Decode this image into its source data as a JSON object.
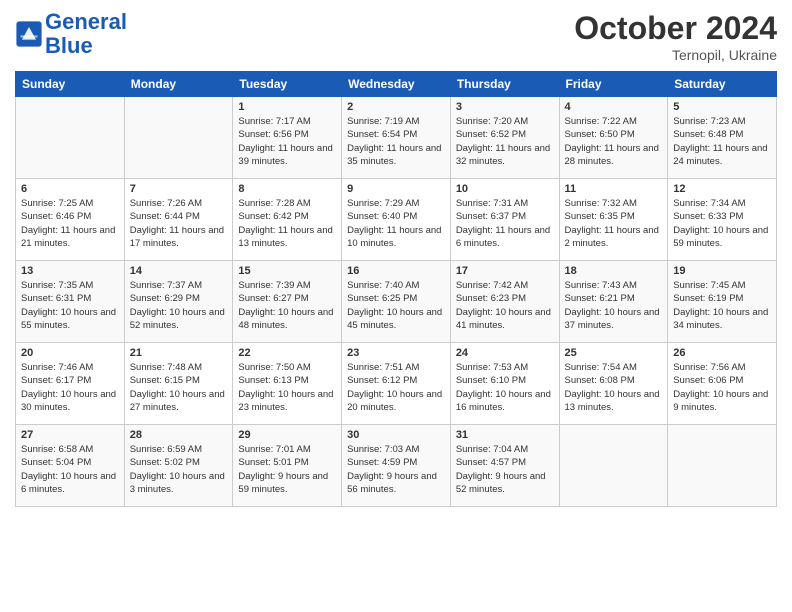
{
  "header": {
    "logo_line1": "General",
    "logo_line2": "Blue",
    "month": "October 2024",
    "location": "Ternopil, Ukraine"
  },
  "weekdays": [
    "Sunday",
    "Monday",
    "Tuesday",
    "Wednesday",
    "Thursday",
    "Friday",
    "Saturday"
  ],
  "weeks": [
    [
      {
        "day": "",
        "info": ""
      },
      {
        "day": "",
        "info": ""
      },
      {
        "day": "1",
        "info": "Sunrise: 7:17 AM\nSunset: 6:56 PM\nDaylight: 11 hours and 39 minutes."
      },
      {
        "day": "2",
        "info": "Sunrise: 7:19 AM\nSunset: 6:54 PM\nDaylight: 11 hours and 35 minutes."
      },
      {
        "day": "3",
        "info": "Sunrise: 7:20 AM\nSunset: 6:52 PM\nDaylight: 11 hours and 32 minutes."
      },
      {
        "day": "4",
        "info": "Sunrise: 7:22 AM\nSunset: 6:50 PM\nDaylight: 11 hours and 28 minutes."
      },
      {
        "day": "5",
        "info": "Sunrise: 7:23 AM\nSunset: 6:48 PM\nDaylight: 11 hours and 24 minutes."
      }
    ],
    [
      {
        "day": "6",
        "info": "Sunrise: 7:25 AM\nSunset: 6:46 PM\nDaylight: 11 hours and 21 minutes."
      },
      {
        "day": "7",
        "info": "Sunrise: 7:26 AM\nSunset: 6:44 PM\nDaylight: 11 hours and 17 minutes."
      },
      {
        "day": "8",
        "info": "Sunrise: 7:28 AM\nSunset: 6:42 PM\nDaylight: 11 hours and 13 minutes."
      },
      {
        "day": "9",
        "info": "Sunrise: 7:29 AM\nSunset: 6:40 PM\nDaylight: 11 hours and 10 minutes."
      },
      {
        "day": "10",
        "info": "Sunrise: 7:31 AM\nSunset: 6:37 PM\nDaylight: 11 hours and 6 minutes."
      },
      {
        "day": "11",
        "info": "Sunrise: 7:32 AM\nSunset: 6:35 PM\nDaylight: 11 hours and 2 minutes."
      },
      {
        "day": "12",
        "info": "Sunrise: 7:34 AM\nSunset: 6:33 PM\nDaylight: 10 hours and 59 minutes."
      }
    ],
    [
      {
        "day": "13",
        "info": "Sunrise: 7:35 AM\nSunset: 6:31 PM\nDaylight: 10 hours and 55 minutes."
      },
      {
        "day": "14",
        "info": "Sunrise: 7:37 AM\nSunset: 6:29 PM\nDaylight: 10 hours and 52 minutes."
      },
      {
        "day": "15",
        "info": "Sunrise: 7:39 AM\nSunset: 6:27 PM\nDaylight: 10 hours and 48 minutes."
      },
      {
        "day": "16",
        "info": "Sunrise: 7:40 AM\nSunset: 6:25 PM\nDaylight: 10 hours and 45 minutes."
      },
      {
        "day": "17",
        "info": "Sunrise: 7:42 AM\nSunset: 6:23 PM\nDaylight: 10 hours and 41 minutes."
      },
      {
        "day": "18",
        "info": "Sunrise: 7:43 AM\nSunset: 6:21 PM\nDaylight: 10 hours and 37 minutes."
      },
      {
        "day": "19",
        "info": "Sunrise: 7:45 AM\nSunset: 6:19 PM\nDaylight: 10 hours and 34 minutes."
      }
    ],
    [
      {
        "day": "20",
        "info": "Sunrise: 7:46 AM\nSunset: 6:17 PM\nDaylight: 10 hours and 30 minutes."
      },
      {
        "day": "21",
        "info": "Sunrise: 7:48 AM\nSunset: 6:15 PM\nDaylight: 10 hours and 27 minutes."
      },
      {
        "day": "22",
        "info": "Sunrise: 7:50 AM\nSunset: 6:13 PM\nDaylight: 10 hours and 23 minutes."
      },
      {
        "day": "23",
        "info": "Sunrise: 7:51 AM\nSunset: 6:12 PM\nDaylight: 10 hours and 20 minutes."
      },
      {
        "day": "24",
        "info": "Sunrise: 7:53 AM\nSunset: 6:10 PM\nDaylight: 10 hours and 16 minutes."
      },
      {
        "day": "25",
        "info": "Sunrise: 7:54 AM\nSunset: 6:08 PM\nDaylight: 10 hours and 13 minutes."
      },
      {
        "day": "26",
        "info": "Sunrise: 7:56 AM\nSunset: 6:06 PM\nDaylight: 10 hours and 9 minutes."
      }
    ],
    [
      {
        "day": "27",
        "info": "Sunrise: 6:58 AM\nSunset: 5:04 PM\nDaylight: 10 hours and 6 minutes."
      },
      {
        "day": "28",
        "info": "Sunrise: 6:59 AM\nSunset: 5:02 PM\nDaylight: 10 hours and 3 minutes."
      },
      {
        "day": "29",
        "info": "Sunrise: 7:01 AM\nSunset: 5:01 PM\nDaylight: 9 hours and 59 minutes."
      },
      {
        "day": "30",
        "info": "Sunrise: 7:03 AM\nSunset: 4:59 PM\nDaylight: 9 hours and 56 minutes."
      },
      {
        "day": "31",
        "info": "Sunrise: 7:04 AM\nSunset: 4:57 PM\nDaylight: 9 hours and 52 minutes."
      },
      {
        "day": "",
        "info": ""
      },
      {
        "day": "",
        "info": ""
      }
    ]
  ]
}
